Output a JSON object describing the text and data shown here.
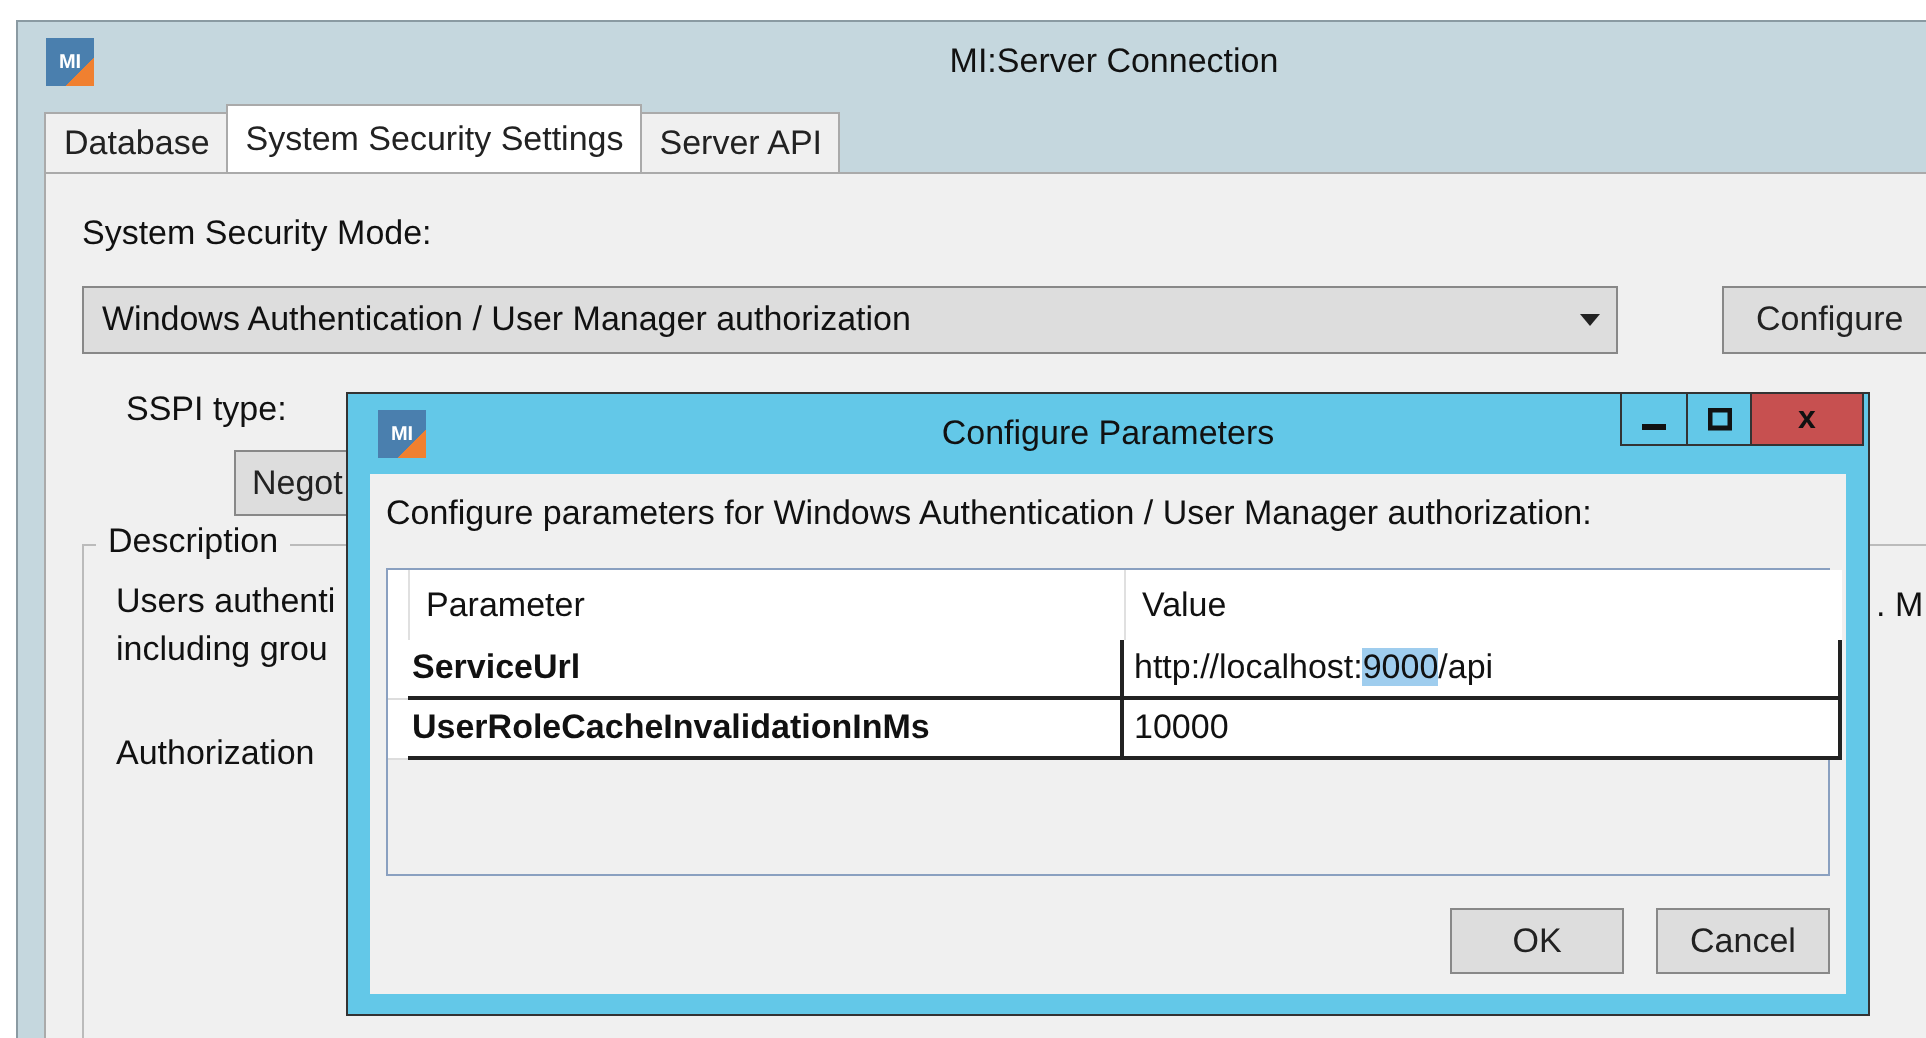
{
  "window": {
    "title": "MI:Server Connection",
    "icon_text": "MI"
  },
  "tabs": [
    {
      "label": "Database",
      "selected": false
    },
    {
      "label": "System Security Settings",
      "selected": true
    },
    {
      "label": "Server API",
      "selected": false
    }
  ],
  "security_mode": {
    "label": "System Security Mode:",
    "value": "Windows Authentication / User Manager authorization",
    "configure_button": "Configure"
  },
  "sspi": {
    "label": "SSPI type:",
    "button": "Negot"
  },
  "description": {
    "legend": "Description",
    "lines": [
      "Users authenti",
      "including grou"
    ],
    "authorization": "Authorization",
    "right_fragment": ". M"
  },
  "dialog": {
    "title": "Configure Parameters",
    "icon_text": "MI",
    "close": "x",
    "prompt": "Configure parameters for Windows Authentication / User Manager authorization:",
    "columns": [
      "Parameter",
      "Value"
    ],
    "rows": [
      {
        "parameter": "ServiceUrl",
        "value_parts": [
          {
            "text": "http://localhost:",
            "selected": false
          },
          {
            "text": "9000",
            "selected": true
          },
          {
            "text": "/api",
            "selected": false
          }
        ]
      },
      {
        "parameter": "UserRoleCacheInvalidationInMs",
        "value_parts": [
          {
            "text": "10000",
            "selected": false
          }
        ]
      }
    ],
    "buttons": [
      "OK",
      "Cancel"
    ]
  }
}
